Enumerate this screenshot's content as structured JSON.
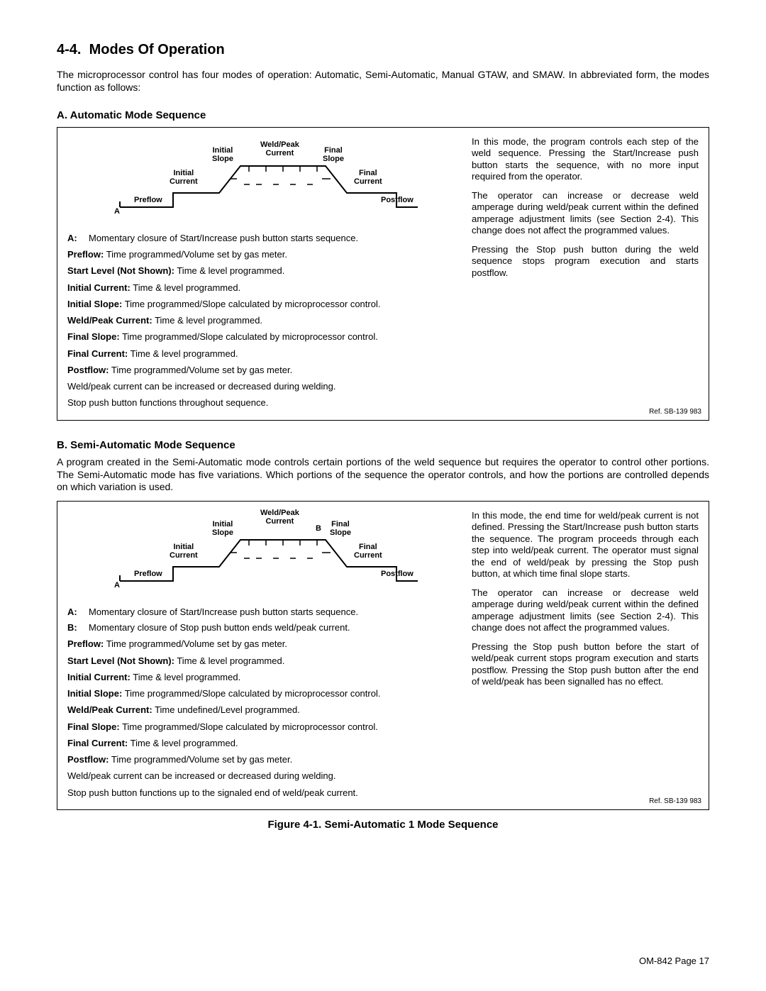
{
  "header": {
    "number": "4-4.",
    "title": "Modes Of Operation"
  },
  "intro": "The microprocessor control has four modes of operation: Automatic, Semi-Automatic, Manual GTAW, and SMAW. In abbreviated form, the modes function as follows:",
  "sectionA": {
    "heading": "A.  Automatic Mode Sequence",
    "diagram": {
      "A": "A",
      "preflow": "Preflow",
      "initial_current": "Initial\nCurrent",
      "initial_slope": "Initial\nSlope",
      "weld_peak": "Weld/Peak\nCurrent",
      "final_slope": "Final\nSlope",
      "final_current": "Final\nCurrent",
      "postflow": "Postflow"
    },
    "lines": {
      "A": "Momentary closure of Start/Increase push button starts sequence.",
      "preflow": "Time programmed/Volume set by gas meter.",
      "start_level": "Time & level programmed.",
      "initial_current": "Time & level programmed.",
      "initial_slope": "Time programmed/Slope calculated by microprocessor control.",
      "weld_peak": "Time & level programmed.",
      "final_slope": "Time programmed/Slope calculated by microprocessor control.",
      "final_current": "Time & level programmed.",
      "postflow": "Time programmed/Volume set by gas meter.",
      "extra1": "Weld/peak current can be increased or decreased during welding.",
      "extra2": "Stop push button functions throughout sequence."
    },
    "labels": {
      "preflow": "Preflow:",
      "start_level": "Start Level (Not Shown):",
      "initial_current": "Initial Current:",
      "initial_slope": "Initial Slope:",
      "weld_peak": "Weld/Peak Current:",
      "final_slope": "Final Slope:",
      "final_current": "Final Current:",
      "postflow": "Postflow:"
    },
    "right": {
      "p1": "In this mode, the program controls each step of the weld sequence. Pressing the Start/Increase push button starts the sequence, with no more input required from the operator.",
      "p2": "The operator can increase or decrease weld amperage during weld/peak current within the defined amperage adjustment limits (see Section 2-4). This change does not affect the programmed values.",
      "p3": "Pressing the Stop push button during the weld sequence stops program execution and starts postflow."
    },
    "ref": "Ref. SB-139 983"
  },
  "sectionB": {
    "heading": "B.  Semi-Automatic Mode Sequence",
    "intro": "A program created in the Semi-Automatic mode controls certain portions of the weld sequence but requires the operator to control other portions. The Semi-Automatic mode has five variations. Which portions of the sequence the operator controls, and how the portions are controlled depends on which variation is used.",
    "diagram": {
      "A": "A",
      "B": "B",
      "preflow": "Preflow",
      "initial_current": "Initial\nCurrent",
      "initial_slope": "Initial\nSlope",
      "weld_peak": "Weld/Peak\nCurrent",
      "final_slope": "Final\nSlope",
      "final_current": "Final\nCurrent",
      "postflow": "Postflow"
    },
    "lines": {
      "A": "Momentary closure of Start/Increase push button starts sequence.",
      "B": "Momentary closure of Stop push button ends weld/peak current.",
      "preflow": "Time programmed/Volume set by gas meter.",
      "start_level": "Time & level programmed.",
      "initial_current": "Time & level programmed.",
      "initial_slope": "Time programmed/Slope calculated by microprocessor control.",
      "weld_peak": "Time undefined/Level programmed.",
      "final_slope": "Time programmed/Slope calculated by microprocessor control.",
      "final_current": "Time & level programmed.",
      "postflow": "Time programmed/Volume set by gas meter.",
      "extra1": "Weld/peak current can be increased or decreased during welding.",
      "extra2": "Stop push button functions up to the signaled end of weld/peak current."
    },
    "labels": {
      "preflow": "Preflow:",
      "start_level": "Start Level (Not Shown):",
      "initial_current": "Initial Current:",
      "initial_slope": "Initial Slope:",
      "weld_peak": "Weld/Peak Current:",
      "final_slope": "Final Slope:",
      "final_current": "Final Current:",
      "postflow": "Postflow:"
    },
    "right": {
      "p1": "In this mode, the end time for weld/peak current is not defined. Pressing the Start/Increase push button starts the sequence. The program proceeds through each step into weld/peak current. The operator must signal the end of weld/peak by pressing the Stop push button, at which time final slope starts.",
      "p2": "The operator can increase or decrease weld amperage during weld/peak current within the defined amperage adjustment limits (see Section 2-4). This change does not affect the programmed values.",
      "p3": "Pressing the Stop push button before the start of weld/peak current stops program execution and starts postflow. Pressing the Stop push button after the end of weld/peak has been signalled has no effect."
    },
    "ref": "Ref. SB-139 983"
  },
  "figure_caption": "Figure 4-1. Semi-Automatic 1 Mode Sequence",
  "footer": "OM-842 Page 17"
}
